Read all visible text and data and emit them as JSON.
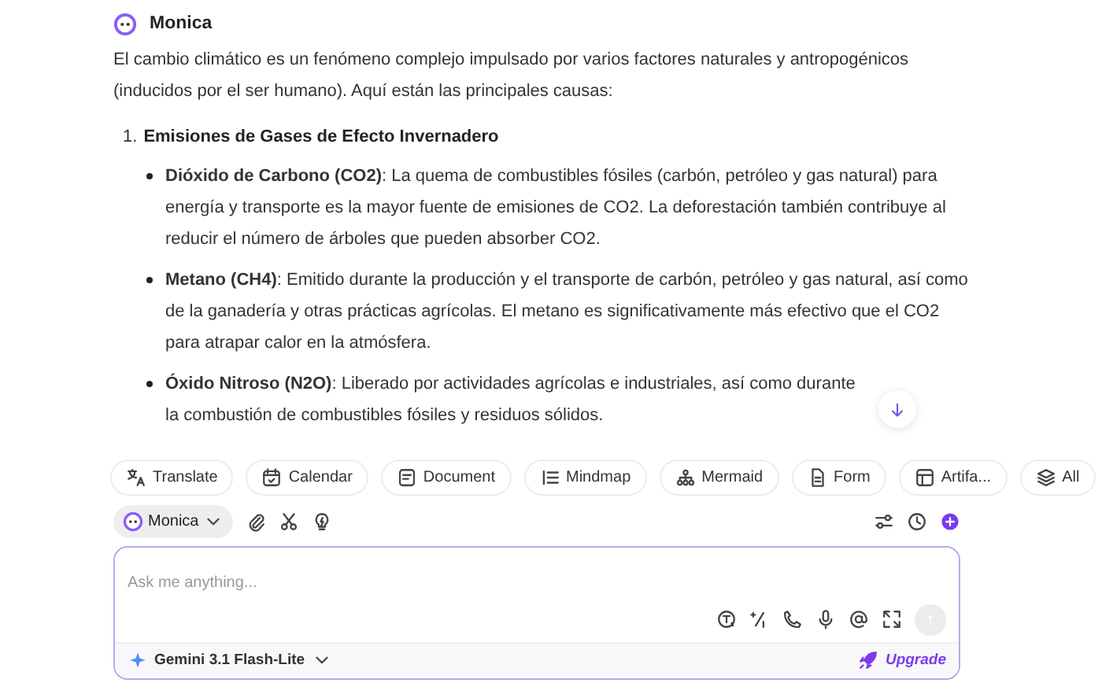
{
  "assistant": {
    "name": "Monica"
  },
  "message": {
    "intro": "El cambio climático es un fenómeno complejo impulsado por varios factores naturales y antropogénicos (inducidos por el ser humano). Aquí están las principales causas:",
    "sections": [
      {
        "number": "1.",
        "title": "Emisiones de Gases de Efecto Invernadero",
        "bullets": [
          "**Dióxido de Carbono (CO2)**: La quema de combustibles fósiles (carbón, petróleo y gas natural) para energía y transporte es la mayor fuente de emisiones de CO2. La deforestación también contribuye al reducir el número de árboles que pueden absorber CO2.",
          "**Metano (CH4)**: Emitido durante la producción y el transporte de carbón, petróleo y gas natural, así como de la ganadería y otras prácticas agrícolas. El metano es significativamente más efectivo que el CO2 para atrapar calor en la atmósfera.",
          "**Óxido Nitroso (N2O)**: Liberado por actividades agrícolas e industriales, así como durante la combustión de combustibles fósiles y residuos sólidos."
        ]
      }
    ]
  },
  "tools": [
    "Translate",
    "Calendar",
    "Document",
    "Mindmap",
    "Mermaid",
    "Form",
    "Artifa...",
    "All"
  ],
  "bot_picker": {
    "label": "Monica"
  },
  "composer": {
    "placeholder": "Ask me anything...",
    "send_disabled": true
  },
  "model": {
    "label": "Gemini 3.1 Flash-Lite"
  },
  "upgrade": {
    "label": "Upgrade"
  }
}
